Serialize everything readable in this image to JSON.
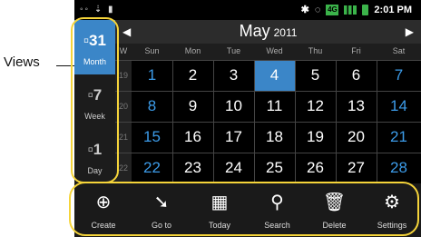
{
  "status_bar": {
    "time": "2:01 PM",
    "network": "4G"
  },
  "callout": {
    "label": "Views"
  },
  "views": [
    {
      "label": "Month",
      "glyph": "31",
      "active": true
    },
    {
      "label": "Week",
      "glyph": "7",
      "active": false
    },
    {
      "label": "Day",
      "glyph": "1",
      "active": false
    }
  ],
  "calendar": {
    "month": "May",
    "year": "2011",
    "prev_icon": "left-arrow",
    "next_icon": "right-arrow",
    "week_header": "W",
    "days": [
      "Sun",
      "Mon",
      "Tue",
      "Wed",
      "Thu",
      "Fri",
      "Sat"
    ],
    "weeks": [
      {
        "num": "19",
        "dates": [
          "1",
          "2",
          "3",
          "4",
          "5",
          "6",
          "7"
        ]
      },
      {
        "num": "20",
        "dates": [
          "8",
          "9",
          "10",
          "11",
          "12",
          "13",
          "14"
        ]
      },
      {
        "num": "21",
        "dates": [
          "15",
          "16",
          "17",
          "18",
          "19",
          "20",
          "21"
        ]
      },
      {
        "num": "22",
        "dates": [
          "22",
          "23",
          "24",
          "25",
          "26",
          "27",
          "28"
        ]
      }
    ],
    "selected_date": "4"
  },
  "toolbar": [
    {
      "label": "Create",
      "icon": "plus-circle-icon"
    },
    {
      "label": "Go to",
      "icon": "goto-arrow-icon"
    },
    {
      "label": "Today",
      "icon": "calendar-icon"
    },
    {
      "label": "Search",
      "icon": "search-icon"
    },
    {
      "label": "Delete",
      "icon": "trash-icon"
    },
    {
      "label": "Settings",
      "icon": "gear-icon"
    }
  ],
  "colors": {
    "accent": "#3b86c8",
    "highlight": "#f5d43a",
    "weekend": "#3c9be8"
  }
}
